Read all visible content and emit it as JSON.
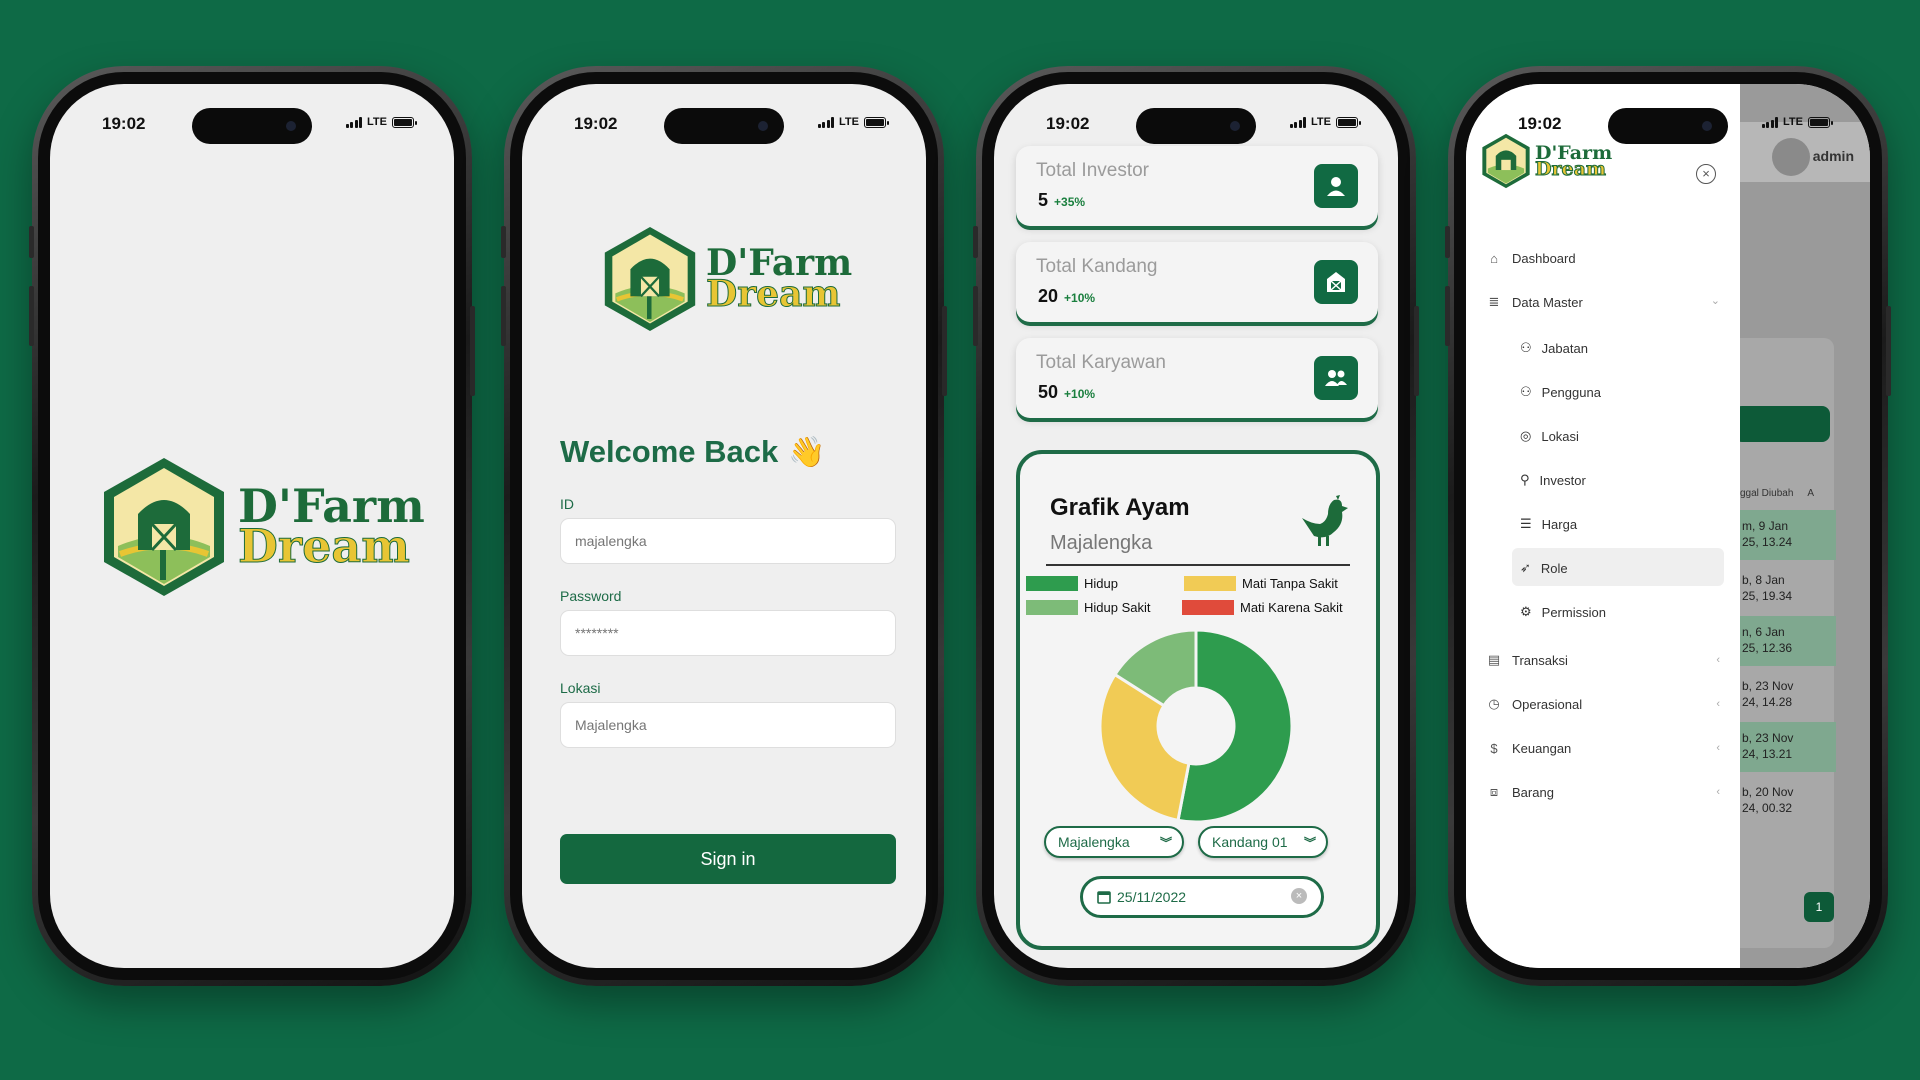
{
  "status": {
    "time": "19:02",
    "network": "LTE"
  },
  "brand": {
    "line1": "D'Farm",
    "line2": "Dream"
  },
  "login": {
    "title": "Welcome Back",
    "wave": "👋",
    "id_label": "ID",
    "id_placeholder": "majalengka",
    "password_label": "Password",
    "password_placeholder": "********",
    "lokasi_label": "Lokasi",
    "lokasi_placeholder": "Majalengka",
    "signin_label": "Sign in"
  },
  "dashboard": {
    "cards": [
      {
        "title": "Total Investor",
        "value": "5",
        "delta": "+35%",
        "icon": "person-icon"
      },
      {
        "title": "Total Kandang",
        "value": "20",
        "delta": "+10%",
        "icon": "barn-icon"
      },
      {
        "title": "Total Karyawan",
        "value": "50",
        "delta": "+10%",
        "icon": "people-icon"
      }
    ],
    "chart_title": "Grafik Ayam",
    "chart_subtitle": "Majalengka",
    "filter_location": "Majalengka",
    "filter_kandang": "Kandang 01",
    "date": "25/11/2022"
  },
  "chart_data": {
    "type": "pie",
    "donut": true,
    "labels": [
      "Hidup",
      "Hidup Sakit",
      "Mati Tanpa Sakit",
      "Mati Karena Sakit"
    ],
    "values": [
      53,
      16,
      31,
      0
    ],
    "colors": [
      "#2e9c4e",
      "#7dbb78",
      "#f1cb55",
      "#e04b3b"
    ]
  },
  "menu": {
    "admin_label": "admin",
    "items": [
      {
        "label": "Dashboard",
        "icon": "home-icon"
      },
      {
        "label": "Data Master",
        "icon": "database-icon"
      }
    ],
    "sub_items": [
      {
        "label": "Jabatan",
        "icon": "users-icon"
      },
      {
        "label": "Pengguna",
        "icon": "users-icon"
      },
      {
        "label": "Lokasi",
        "icon": "location-icon"
      },
      {
        "label": "Investor",
        "icon": "user-plus-icon"
      },
      {
        "label": "Harga",
        "icon": "list-icon"
      },
      {
        "label": "Role",
        "icon": "rocket-icon"
      },
      {
        "label": "Permission",
        "icon": "settings-icon"
      }
    ],
    "groups": [
      {
        "label": "Transaksi",
        "icon": "receipt-icon"
      },
      {
        "label": "Operasional",
        "icon": "clock-icon"
      },
      {
        "label": "Keuangan",
        "icon": "dollar-icon"
      },
      {
        "label": "Barang",
        "icon": "box-icon"
      }
    ],
    "bg_header": "ggal Diubah",
    "bg_header_extra": "A",
    "bg_rows": [
      {
        "l1": "m, 9 Jan",
        "l2": "25, 13.24"
      },
      {
        "l1": "b, 8 Jan",
        "l2": "25, 19.34"
      },
      {
        "l1": "n, 6 Jan",
        "l2": "25, 12.36"
      },
      {
        "l1": "b, 23 Nov",
        "l2": "24, 14.28"
      },
      {
        "l1": "b, 23 Nov",
        "l2": "24, 13.21"
      },
      {
        "l1": "b, 20 Nov",
        "l2": "24, 00.32"
      }
    ],
    "page_number": "1"
  }
}
